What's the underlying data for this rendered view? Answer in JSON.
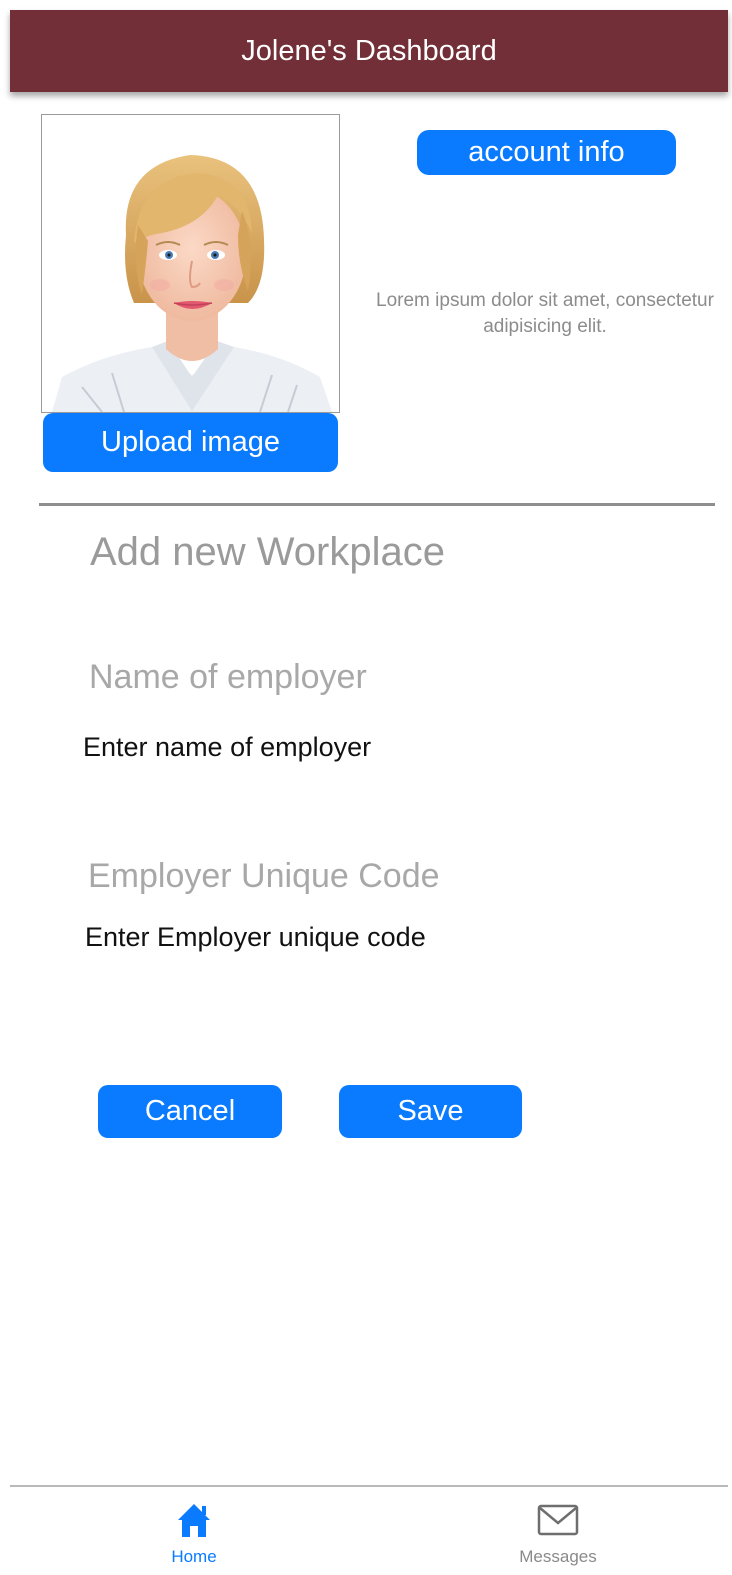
{
  "header": {
    "title": "Jolene's Dashboard"
  },
  "profile": {
    "photo_icon": "profile-photo",
    "upload_label": "Upload image",
    "account_label": "account info",
    "description": "Lorem ipsum dolor sit amet, consectetur adipisicing elit."
  },
  "form": {
    "title": "Add new Workplace",
    "employer_label": "Name of employer",
    "employer_placeholder": "Enter name of employer",
    "employer_value": "",
    "code_label": "Employer Unique Code",
    "code_placeholder": "Enter Employer unique code",
    "code_value": "",
    "cancel_label": "Cancel",
    "save_label": "Save"
  },
  "tabbar": {
    "items": [
      {
        "label": "Home",
        "icon": "home-icon",
        "active": true
      },
      {
        "label": "Messages",
        "icon": "envelope-icon",
        "active": false
      }
    ]
  },
  "colors": {
    "header_bg": "#722f37",
    "primary": "#0a7bff",
    "muted_text": "#9a9a9a",
    "inactive_tab": "#8a8a8a"
  }
}
